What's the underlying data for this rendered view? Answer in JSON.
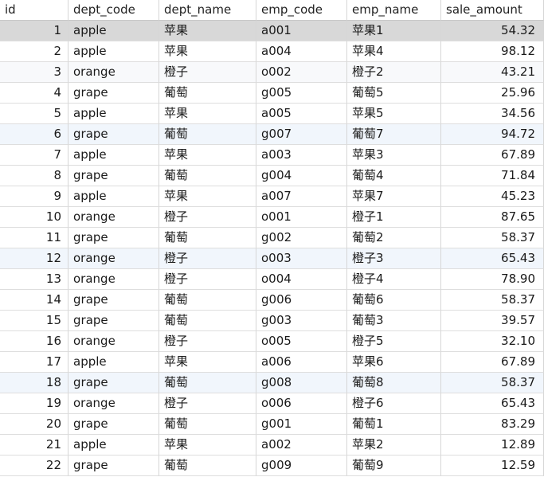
{
  "columns": [
    {
      "key": "id",
      "label": "id"
    },
    {
      "key": "dept_code",
      "label": "dept_code"
    },
    {
      "key": "dept_name",
      "label": "dept_name"
    },
    {
      "key": "emp_code",
      "label": "emp_code"
    },
    {
      "key": "emp_name",
      "label": "emp_name"
    },
    {
      "key": "sale_amount",
      "label": "sale_amount"
    }
  ],
  "rows": [
    {
      "id": "1",
      "dept_code": "apple",
      "dept_name": "苹果",
      "emp_code": "a001",
      "emp_name": "苹果1",
      "sale_amount": "54.32"
    },
    {
      "id": "2",
      "dept_code": "apple",
      "dept_name": "苹果",
      "emp_code": "a004",
      "emp_name": "苹果4",
      "sale_amount": "98.12"
    },
    {
      "id": "3",
      "dept_code": "orange",
      "dept_name": "橙子",
      "emp_code": "o002",
      "emp_name": "橙子2",
      "sale_amount": "43.21"
    },
    {
      "id": "4",
      "dept_code": "grape",
      "dept_name": "葡萄",
      "emp_code": "g005",
      "emp_name": "葡萄5",
      "sale_amount": "25.96"
    },
    {
      "id": "5",
      "dept_code": "apple",
      "dept_name": "苹果",
      "emp_code": "a005",
      "emp_name": "苹果5",
      "sale_amount": "34.56"
    },
    {
      "id": "6",
      "dept_code": "grape",
      "dept_name": "葡萄",
      "emp_code": "g007",
      "emp_name": "葡萄7",
      "sale_amount": "94.72"
    },
    {
      "id": "7",
      "dept_code": "apple",
      "dept_name": "苹果",
      "emp_code": "a003",
      "emp_name": "苹果3",
      "sale_amount": "67.89"
    },
    {
      "id": "8",
      "dept_code": "grape",
      "dept_name": "葡萄",
      "emp_code": "g004",
      "emp_name": "葡萄4",
      "sale_amount": "71.84"
    },
    {
      "id": "9",
      "dept_code": "apple",
      "dept_name": "苹果",
      "emp_code": "a007",
      "emp_name": "苹果7",
      "sale_amount": "45.23"
    },
    {
      "id": "10",
      "dept_code": "orange",
      "dept_name": "橙子",
      "emp_code": "o001",
      "emp_name": "橙子1",
      "sale_amount": "87.65"
    },
    {
      "id": "11",
      "dept_code": "grape",
      "dept_name": "葡萄",
      "emp_code": "g002",
      "emp_name": "葡萄2",
      "sale_amount": "58.37"
    },
    {
      "id": "12",
      "dept_code": "orange",
      "dept_name": "橙子",
      "emp_code": "o003",
      "emp_name": "橙子3",
      "sale_amount": "65.43"
    },
    {
      "id": "13",
      "dept_code": "orange",
      "dept_name": "橙子",
      "emp_code": "o004",
      "emp_name": "橙子4",
      "sale_amount": "78.90"
    },
    {
      "id": "14",
      "dept_code": "grape",
      "dept_name": "葡萄",
      "emp_code": "g006",
      "emp_name": "葡萄6",
      "sale_amount": "58.37"
    },
    {
      "id": "15",
      "dept_code": "grape",
      "dept_name": "葡萄",
      "emp_code": "g003",
      "emp_name": "葡萄3",
      "sale_amount": "39.57"
    },
    {
      "id": "16",
      "dept_code": "orange",
      "dept_name": "橙子",
      "emp_code": "o005",
      "emp_name": "橙子5",
      "sale_amount": "32.10"
    },
    {
      "id": "17",
      "dept_code": "apple",
      "dept_name": "苹果",
      "emp_code": "a006",
      "emp_name": "苹果6",
      "sale_amount": "67.89"
    },
    {
      "id": "18",
      "dept_code": "grape",
      "dept_name": "葡萄",
      "emp_code": "g008",
      "emp_name": "葡萄8",
      "sale_amount": "58.37"
    },
    {
      "id": "19",
      "dept_code": "orange",
      "dept_name": "橙子",
      "emp_code": "o006",
      "emp_name": "橙子6",
      "sale_amount": "65.43"
    },
    {
      "id": "20",
      "dept_code": "grape",
      "dept_name": "葡萄",
      "emp_code": "g001",
      "emp_name": "葡萄1",
      "sale_amount": "83.29"
    },
    {
      "id": "21",
      "dept_code": "apple",
      "dept_name": "苹果",
      "emp_code": "a002",
      "emp_name": "苹果2",
      "sale_amount": "12.89"
    },
    {
      "id": "22",
      "dept_code": "grape",
      "dept_name": "葡萄",
      "emp_code": "g009",
      "emp_name": "葡萄9",
      "sale_amount": "12.59"
    }
  ],
  "selected_row": "1"
}
